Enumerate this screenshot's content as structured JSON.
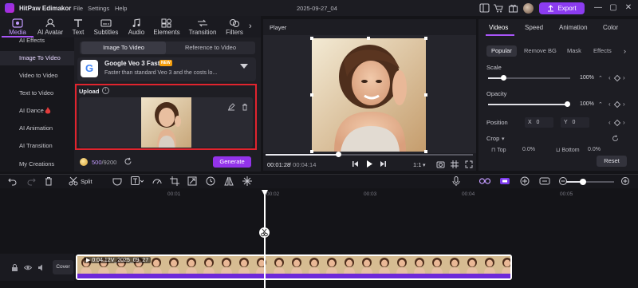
{
  "app": {
    "title": "HitPaw Edimakor",
    "menus": [
      "File",
      "Settings",
      "Help"
    ],
    "project_name": "2025-09-27_04",
    "export_label": "Export",
    "accent": "#8b3cf0"
  },
  "toolbar": {
    "tools": [
      {
        "label": "Media",
        "icon": "media-icon"
      },
      {
        "label": "AI Avatar",
        "icon": "ai-avatar-icon"
      },
      {
        "label": "Text",
        "icon": "text-icon"
      },
      {
        "label": "Subtitles",
        "icon": "subtitles-icon"
      },
      {
        "label": "Audio",
        "icon": "audio-icon"
      },
      {
        "label": "Elements",
        "icon": "elements-icon"
      },
      {
        "label": "Transition",
        "icon": "transition-icon"
      },
      {
        "label": "Filters",
        "icon": "filters-icon"
      }
    ],
    "active": "Media"
  },
  "left_nav": {
    "items": [
      "AI Effects",
      "Image To Video",
      "Video to Video",
      "Text to Video",
      "AI Dance",
      "AI Animation",
      "AI Transition",
      "My Creations"
    ],
    "active": "Image To Video"
  },
  "media_panel": {
    "mode_tabs": [
      "Image To Video",
      "Reference to Video"
    ],
    "active_mode": "Image To Video",
    "model": {
      "name": "Google Veo 3 Fast",
      "badge": "NEW",
      "description": "Faster than standard Veo 3 and the costs lo..."
    },
    "upload_label": "Upload",
    "credits_used": "500",
    "credits_total": "/9200",
    "generate_label": "Generate"
  },
  "player": {
    "title": "Player",
    "time_current": "00:01:28",
    "time_total": "/ 00:04:14",
    "progress": 0.35,
    "ratio": "1:1"
  },
  "properties": {
    "tabs": [
      "Videos",
      "Speed",
      "Animation",
      "Color"
    ],
    "active_tab": "Videos",
    "sub_tabs": [
      "Popular",
      "Remove BG",
      "Mask",
      "Effects"
    ],
    "active_sub_tab": "Popular",
    "scale_label": "Scale",
    "scale_value": "100%",
    "opacity_label": "Opacity",
    "opacity_value": "100%",
    "position_label": "Position",
    "pos_x_label": "X",
    "pos_x": "0",
    "pos_y_label": "Y",
    "pos_y": "0",
    "crop_label": "Crop",
    "crop_top_label": "Top",
    "crop_top": "0.0%",
    "crop_bottom_label": "Bottom",
    "crop_bottom": "0.0%",
    "reset_label": "Reset"
  },
  "timeline": {
    "split_label": "Split",
    "ticks": [
      "00:01",
      "00:02",
      "00:03",
      "00:04",
      "00:05"
    ],
    "cover_label": "Cover",
    "clip_label": "0:04:12V_2025_09_27",
    "zoom": 0.35
  }
}
